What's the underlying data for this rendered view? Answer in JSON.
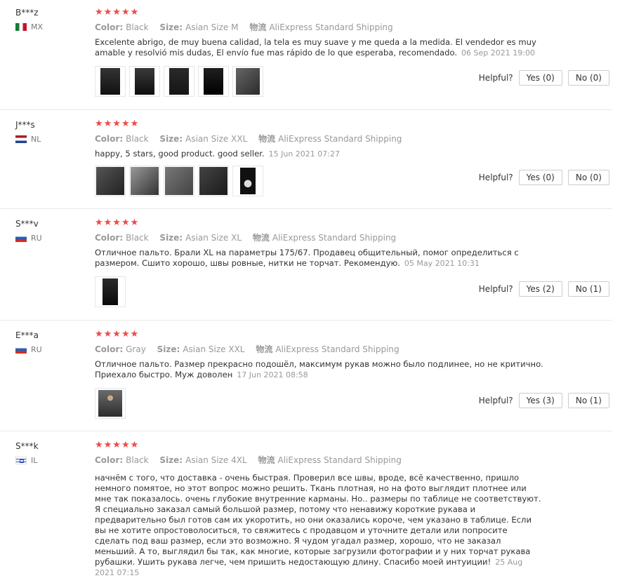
{
  "labels": {
    "color": "Color:",
    "size": "Size:",
    "shipping": "物流",
    "helpful": "Helpful?"
  },
  "reviews": [
    {
      "user": "B***z",
      "country": "MX",
      "stars": "★★★★★",
      "color": "Black",
      "size": "Asian Size M",
      "shipping": "AliExpress Standard Shipping",
      "text": "Excelente abrigo, de muy buena calidad, la tela es muy suave y me queda a la medida. El vendedor es muy amable y resolvió mis dudas, El envío fue mas rápido de lo que esperaba, recomendado.",
      "date": "06 Sep 2021 19:00",
      "yes": "Yes (0)",
      "no": "No (0)",
      "photos": 5
    },
    {
      "user": "J***s",
      "country": "NL",
      "stars": "★★★★★",
      "color": "Black",
      "size": "Asian Size XXL",
      "shipping": "AliExpress Standard Shipping",
      "text": "happy, 5 stars, good product. good seller.",
      "date": "15 Jun 2021 07:27",
      "yes": "Yes (0)",
      "no": "No (0)",
      "photos": 5
    },
    {
      "user": "S***v",
      "country": "RU",
      "stars": "★★★★★",
      "color": "Black",
      "size": "Asian Size XL",
      "shipping": "AliExpress Standard Shipping",
      "text": "Отличное пальто. Брали XL на параметры 175/67. Продавец общительный, помог определиться с размером. Сшито хорошо, швы ровные, нитки не торчат. Рекомендую.",
      "date": "05 May 2021 10:31",
      "yes": "Yes (2)",
      "no": "No (1)",
      "photos": 1
    },
    {
      "user": "E***a",
      "country": "RU",
      "stars": "★★★★★",
      "color": "Gray",
      "size": "Asian Size XXL",
      "shipping": "AliExpress Standard Shipping",
      "text": "Отличное пальто. Размер прекрасно подошёл, максимум рукав можно было подлинее, но не критично. Приехало быстро. Муж доволен",
      "date": "17 Jun 2021 08:58",
      "yes": "Yes (3)",
      "no": "No (1)",
      "photos": 1
    },
    {
      "user": "S***k",
      "country": "IL",
      "stars": "★★★★★",
      "color": "Black",
      "size": "Asian Size 4XL",
      "shipping": "AliExpress Standard Shipping",
      "text": "начнём с того, что доставка - очень быстрая. Проверил все швы, вроде, всё качественно, пришло немного помятое, но этот вопрос можно решить. Ткань плотная, но на фото выглядит плотнее или мне так показалось. очень глубокие внутренние карманы. Но.. размеры по таблице не соответствуют. Я специально заказал самый большой размер, потому что ненавижу короткие рукава и предварительно был готов сам их укоротить, но они оказались короче, чем указано в таблице. Если вы не хотите опростоволоситься, то свяжитесь с продавцом и уточните детали или попросите сделать под ваш размер, если это возможно. Я чудом угадал размер, хорошо, что не заказал меньший. А то, выглядил бы так, как многие, которые загрузили фотографии и у них торчат рукава рубашки. Ушить рукава легче, чем пришить недостающую длину. Спасибо моей интуиции!",
      "date": "25 Aug 2021 07:15"
    }
  ]
}
